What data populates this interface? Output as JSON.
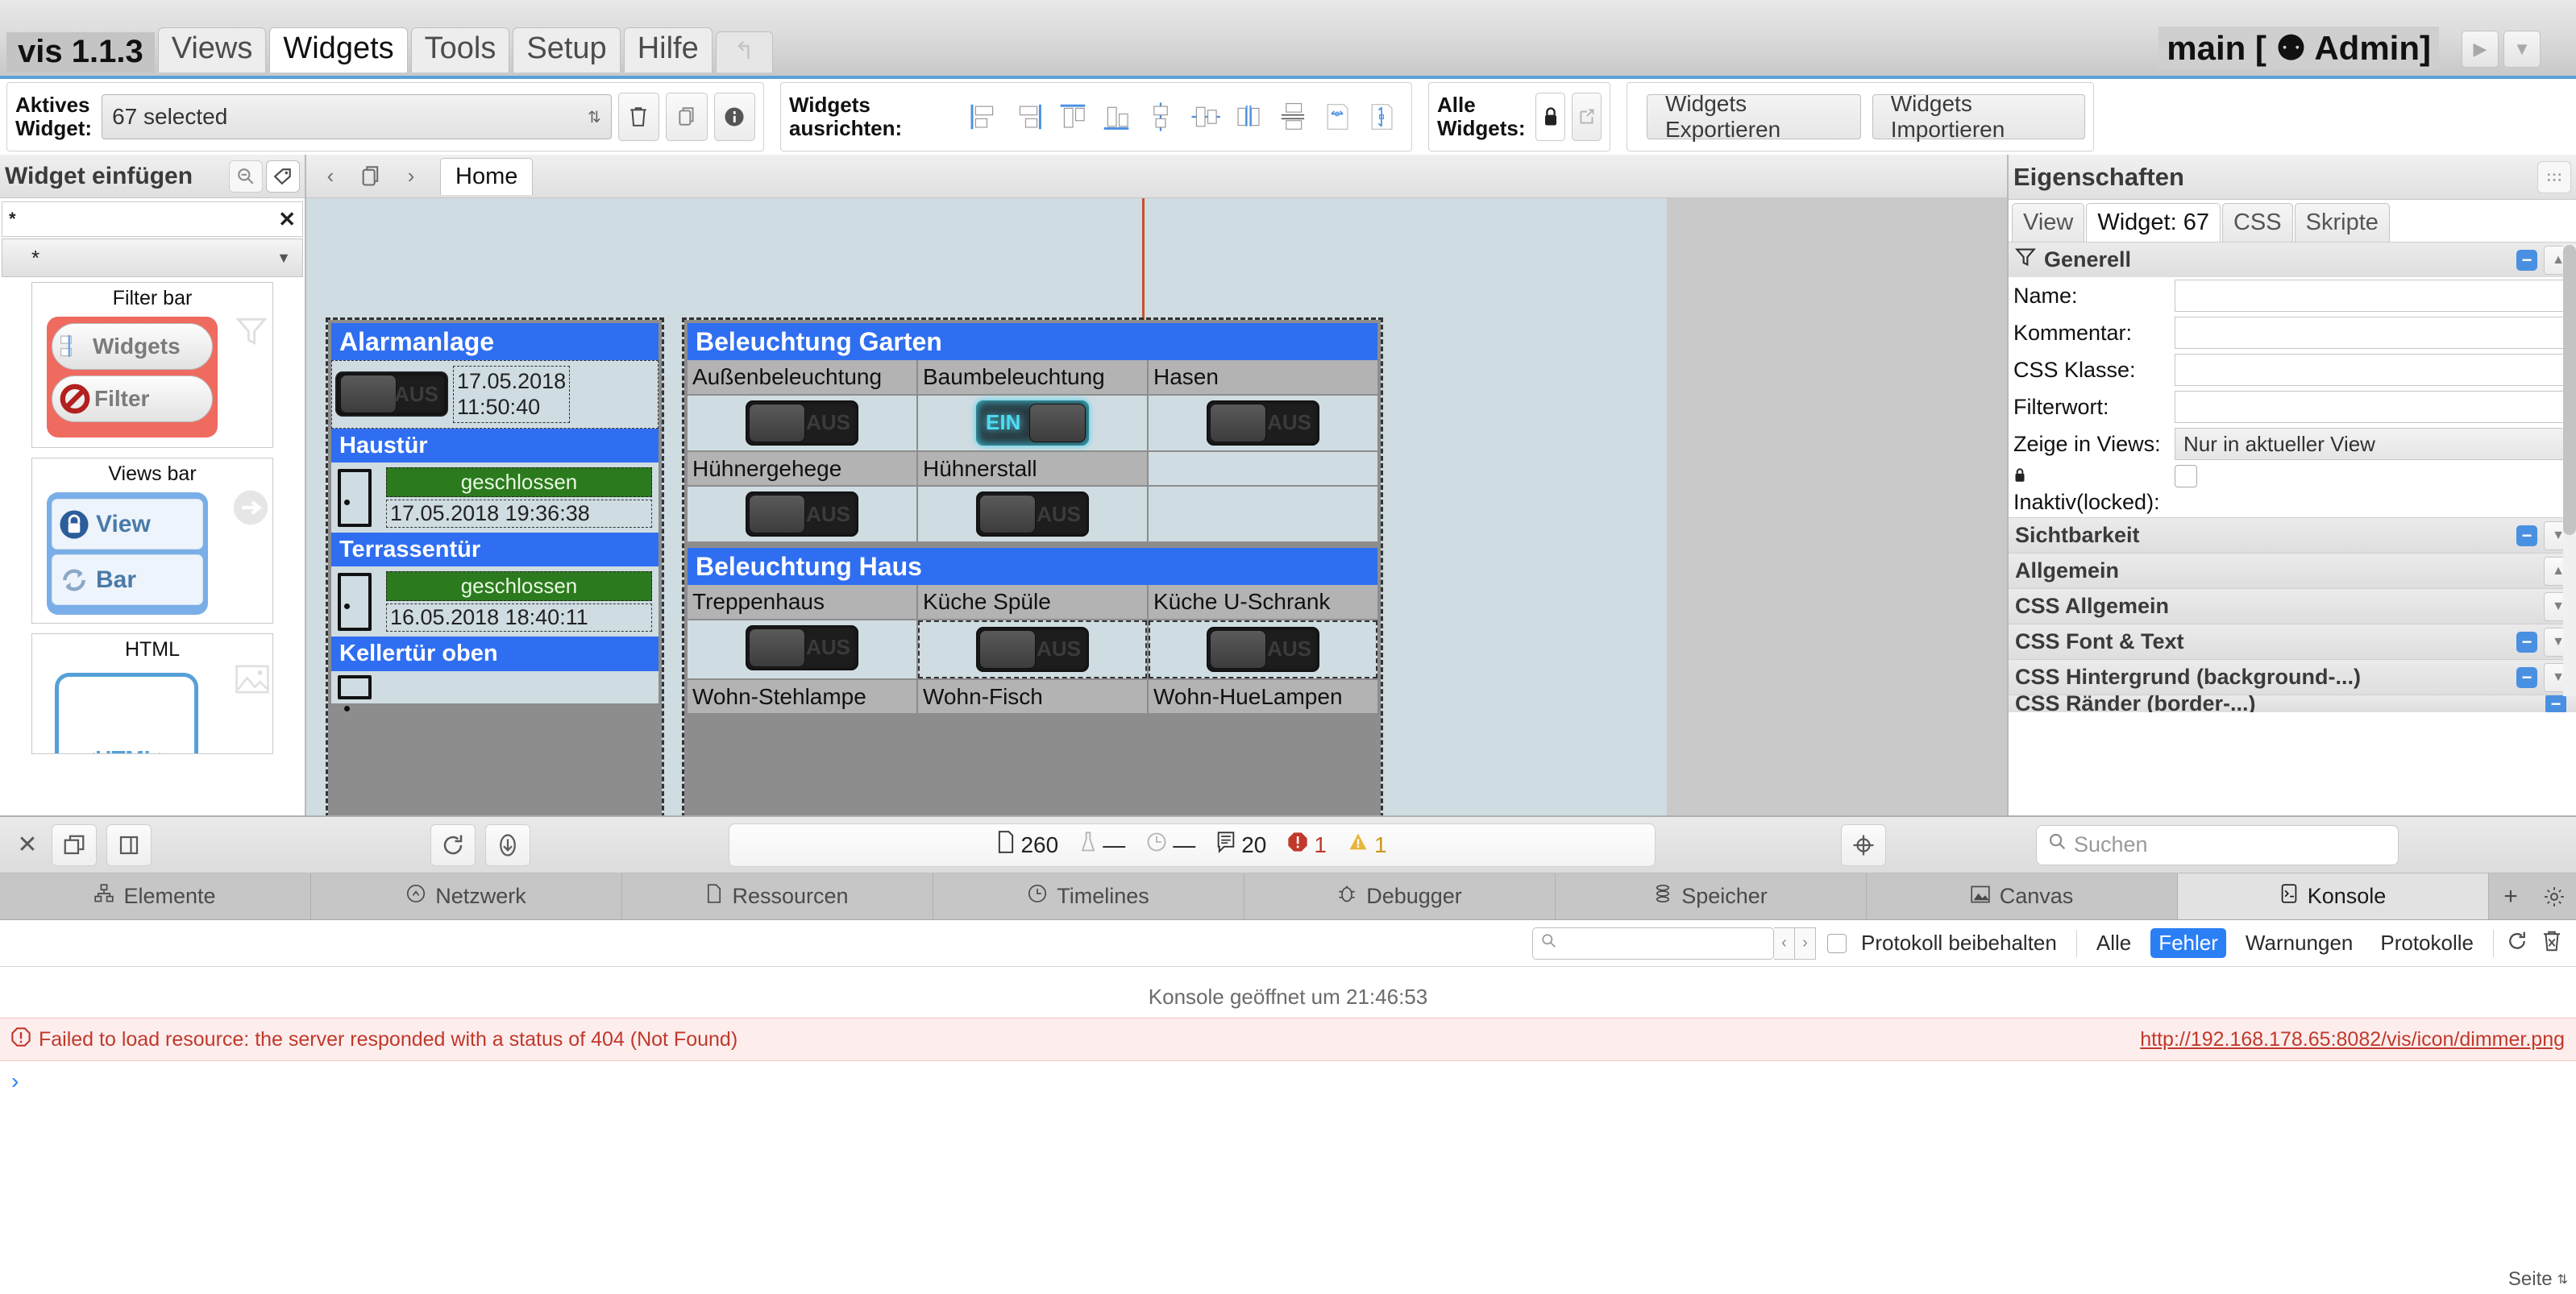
{
  "menubar": {
    "app_title": "vis 1.1.3",
    "tabs": [
      {
        "label": "Views",
        "active": false
      },
      {
        "label": "Widgets",
        "active": true
      },
      {
        "label": "Tools",
        "active": false
      },
      {
        "label": "Setup",
        "active": false
      },
      {
        "label": "Hilfe",
        "active": false
      }
    ],
    "undo_icon": "undo-icon",
    "page_title": "main [ ⚉ Admin]",
    "play_icon": "play-icon",
    "dropdown_icon": "chevron-down-icon"
  },
  "toolbar": {
    "active_widget_label_line1": "Aktives",
    "active_widget_label_line2": "Widget:",
    "active_widget_value": "67 selected",
    "delete_icon": "trash-icon",
    "copy_icon": "copy-icon",
    "info_icon": "info-icon",
    "align_label": "Widgets ausrichten:",
    "align_icons": [
      "align-left-icon",
      "align-right-icon",
      "align-top-icon",
      "align-bottom-icon",
      "align-center-vertical-icon",
      "align-center-horizontal-icon",
      "distribute-horizontal-icon",
      "distribute-vertical-icon",
      "same-width-icon",
      "same-height-icon"
    ],
    "all_widgets_label": "Alle Widgets:",
    "lock_icon": "lock-icon",
    "external-link_icon": "external-link-icon",
    "export_label": "Widgets Exportieren",
    "import_label": "Widgets Importieren"
  },
  "left_panel": {
    "title": "Widget einfügen",
    "zoom_out_icon": "zoom-out-icon",
    "tag_icon": "tag-icon",
    "filter_value": "*",
    "clear_icon": "close-icon",
    "category_value": "*",
    "category_caret": "chevron-down-icon",
    "widgets": [
      {
        "title": "Filter bar",
        "kind": "filterbar",
        "items": [
          "Widgets",
          "Filter"
        ],
        "corner_icon": "funnel-icon"
      },
      {
        "title": "Views bar",
        "kind": "viewsbar",
        "items": [
          "View",
          "Bar"
        ],
        "corner_icon": "arrow-right-circle-icon"
      },
      {
        "title": "HTML",
        "kind": "html",
        "items": [
          "<HTML>"
        ],
        "corner_icon": "image-icon"
      }
    ]
  },
  "canvas_nav": {
    "back_icon": "chevron-left-icon",
    "copy_icon": "copy-view-icon",
    "forward_icon": "chevron-right-icon",
    "view_tab": "Home"
  },
  "canvas": {
    "panels": [
      {
        "name": "alarmanlage",
        "sections": [
          {
            "header": "Alarmanlage",
            "type": "toggle-ts",
            "toggle_state": "AUS",
            "timestamp_line1": "17.05.2018",
            "timestamp_line2": "11:50:40"
          },
          {
            "header": "Haustür",
            "type": "door",
            "status": "geschlossen",
            "timestamp": "17.05.2018 19:36:38"
          },
          {
            "header": "Terrassentür",
            "type": "door",
            "status": "geschlossen",
            "timestamp": "16.05.2018 18:40:11"
          },
          {
            "header": "Kellertür oben",
            "type": "door",
            "status": "",
            "timestamp": ""
          }
        ]
      },
      {
        "name": "beleuchtung",
        "sections": [
          {
            "header": "Beleuchtung Garten",
            "type": "grid",
            "rows": [
              [
                {
                  "label": "Außenbeleuchtung",
                  "state": "AUS"
                },
                {
                  "label": "Baumbeleuchtung",
                  "state": "EIN"
                },
                {
                  "label": "Hasen",
                  "state": "AUS"
                }
              ],
              [
                {
                  "label": "Hühnergehege",
                  "state": "AUS"
                },
                {
                  "label": "Hühnerstall",
                  "state": "AUS"
                },
                {
                  "label": "",
                  "state": ""
                }
              ]
            ]
          },
          {
            "header": "Beleuchtung Haus",
            "type": "grid",
            "rows": [
              [
                {
                  "label": "Treppenhaus",
                  "state": "AUS"
                },
                {
                  "label": "Küche Spüle",
                  "state": "AUS"
                },
                {
                  "label": "Küche U-Schrank",
                  "state": "AUS"
                }
              ],
              [
                {
                  "label": "Wohn-Stehlampe",
                  "state": ""
                },
                {
                  "label": "Wohn-Fisch",
                  "state": ""
                },
                {
                  "label": "Wohn-HueLampen",
                  "state": ""
                }
              ]
            ]
          }
        ]
      }
    ]
  },
  "props": {
    "title": "Eigenschaften",
    "grip_icon": "grip-icon",
    "tabs": [
      {
        "label": "View",
        "active": false
      },
      {
        "label": "Widget: 67",
        "active": true
      },
      {
        "label": "CSS",
        "active": false
      },
      {
        "label": "Skripte",
        "active": false
      }
    ],
    "generell": {
      "funnel_icon": "funnel-icon",
      "header": "Generell",
      "fields": [
        {
          "label": "Name:",
          "value": "",
          "type": "input"
        },
        {
          "label": "Kommentar:",
          "value": "",
          "type": "input"
        },
        {
          "label": "CSS Klasse:",
          "value": "",
          "type": "input"
        },
        {
          "label": "Filterwort:",
          "value": "",
          "type": "input"
        },
        {
          "label": "Zeige in Views:",
          "value": "Nur in aktueller View",
          "type": "select"
        }
      ],
      "locked_icon": "lock-icon",
      "locked_label": "Inaktiv(locked):",
      "locked_checked": false
    },
    "accordions": [
      {
        "label": "Sichtbarkeit",
        "minus": true,
        "arrow": "down"
      },
      {
        "label": "Allgemein",
        "minus": false,
        "arrow": "up"
      },
      {
        "label": "CSS Allgemein",
        "minus": false,
        "arrow": "down"
      },
      {
        "label": "CSS Font & Text",
        "minus": true,
        "arrow": "down"
      },
      {
        "label": "CSS Hintergrund (background-...)",
        "minus": true,
        "arrow": "down"
      },
      {
        "label": "CSS Ränder (border-...)",
        "minus": true,
        "arrow": "down"
      }
    ]
  },
  "devtools": {
    "close_icon": "close-icon",
    "dock_icon": "dock-window-icon",
    "split_icon": "split-panel-icon",
    "reload_icon": "reload-icon",
    "download_icon": "download-icon",
    "stats": {
      "file_icon": "file-icon",
      "file_count": "260",
      "flask_icon": "flask-icon",
      "flask_value": "—",
      "clock_icon": "clock-icon",
      "clock_value": "—",
      "message_icon": "message-icon",
      "message_count": "20",
      "error_icon": "error-icon",
      "error_count": "1",
      "warning_icon": "warning-icon",
      "warning_count": "1"
    },
    "target_icon": "crosshair-icon",
    "search_icon": "search-icon",
    "search_placeholder": "Suchen",
    "tabs": [
      {
        "label": "Elemente",
        "icon": "elements-icon",
        "active": false
      },
      {
        "label": "Netzwerk",
        "icon": "network-icon",
        "active": false
      },
      {
        "label": "Ressourcen",
        "icon": "resources-icon",
        "active": false
      },
      {
        "label": "Timelines",
        "icon": "timeline-icon",
        "active": false
      },
      {
        "label": "Debugger",
        "icon": "bug-icon",
        "active": false
      },
      {
        "label": "Speicher",
        "icon": "memory-icon",
        "active": false
      },
      {
        "label": "Canvas",
        "icon": "canvas-icon",
        "active": false
      },
      {
        "label": "Konsole",
        "icon": "console-icon",
        "active": true
      }
    ],
    "tab_add_icon": "plus-icon",
    "tab_settings_icon": "gear-icon",
    "console_filter": {
      "search_icon": "search-icon",
      "search_value": "",
      "prev_icon": "chevron-left-icon",
      "next_icon": "chevron-right-icon",
      "keep_log_label": "Protokoll beibehalten",
      "keep_log_checked": false,
      "levels": [
        {
          "label": "Alle",
          "active": false
        },
        {
          "label": "Fehler",
          "active": true
        },
        {
          "label": "Warnungen",
          "active": false
        },
        {
          "label": "Protokolle",
          "active": false
        }
      ],
      "refresh_icon": "refresh-icon",
      "clear_icon": "trash-icon"
    },
    "console_opened": "Konsole geöffnet um 21:46:53",
    "error_icon": "error-icon",
    "error_message": "Failed to load resource: the server responded with a status of 404 (Not Found)",
    "error_link": "http://192.168.178.65:8082/vis/icon/dimmer.png",
    "prompt_caret": "›",
    "page_status": "Seite",
    "page_status_caret": "chevron-updown-icon"
  },
  "colors": {
    "accent_blue": "#2b7ff5",
    "header_blue": "#2f6ef0",
    "error_red": "#c0392b",
    "status_green": "#2b7a1e",
    "toggle_on_cyan": "#4fdcf5"
  }
}
